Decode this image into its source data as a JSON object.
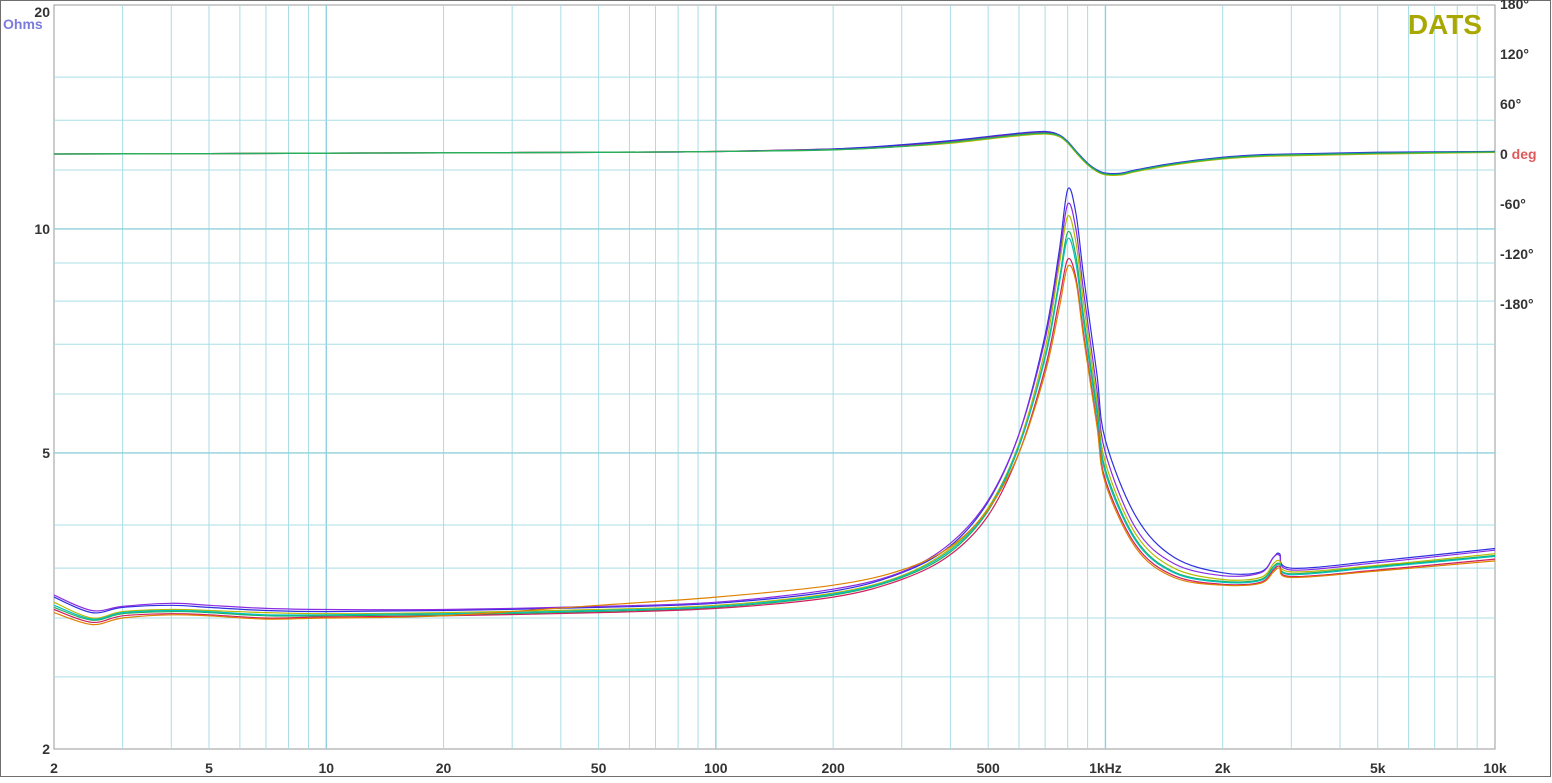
{
  "chart_data": {
    "type": "line",
    "logo": "DATS",
    "x_scale": "log",
    "xlim": [
      2,
      10000
    ],
    "x_ticks": [
      {
        "v": 2,
        "label": "2"
      },
      {
        "v": 5,
        "label": "5"
      },
      {
        "v": 10,
        "label": "10"
      },
      {
        "v": 20,
        "label": "20"
      },
      {
        "v": 50,
        "label": "50"
      },
      {
        "v": 100,
        "label": "100"
      },
      {
        "v": 200,
        "label": "200"
      },
      {
        "v": 500,
        "label": "500"
      },
      {
        "v": 1000,
        "label": "1kHz"
      },
      {
        "v": 2000,
        "label": "2k"
      },
      {
        "v": 5000,
        "label": "5k"
      },
      {
        "v": 10000,
        "label": "10k"
      }
    ],
    "y_left": {
      "unit_label": "Ohms",
      "scale": "log",
      "ylim": [
        2,
        20
      ],
      "ticks": [
        {
          "v": 20,
          "label": "20"
        },
        {
          "v": 10,
          "label": "10"
        },
        {
          "v": 5,
          "label": "5"
        },
        {
          "v": 2,
          "label": "2"
        }
      ]
    },
    "y_right": {
      "unit_label": "deg",
      "scale": "linear",
      "ylim": [
        -180,
        180
      ],
      "ticks": [
        {
          "v": 180,
          "label": "180°"
        },
        {
          "v": 120,
          "label": "120°"
        },
        {
          "v": 60,
          "label": "60°"
        },
        {
          "v": 0,
          "label": "0"
        },
        {
          "v": -60,
          "label": "-60°"
        },
        {
          "v": -120,
          "label": "-120°"
        },
        {
          "v": -180,
          "label": "-180°"
        }
      ]
    },
    "grid": true,
    "colors": {
      "grid": "#a8dde6",
      "grid_major": "#8fd0dc",
      "ohms_label": "#7b7bdc",
      "deg_label": "#e05a5a",
      "logo": "#a8a800"
    },
    "impedance_x": [
      2,
      2.5,
      3,
      4,
      5,
      7,
      10,
      20,
      50,
      100,
      200,
      300,
      400,
      500,
      600,
      700,
      760,
      800,
      840,
      880,
      950,
      1000,
      1200,
      1500,
      2000,
      2500,
      2700,
      2800,
      3000,
      5000,
      10000
    ],
    "phase_x": [
      2,
      5,
      10,
      20,
      50,
      100,
      200,
      300,
      400,
      500,
      600,
      700,
      760,
      800,
      850,
      900,
      950,
      1000,
      1100,
      1200,
      1500,
      2000,
      2500,
      3000,
      5000,
      10000
    ],
    "impedance_series": [
      {
        "color": "#3030e0",
        "values": [
          3.2,
          3.05,
          3.1,
          3.12,
          3.1,
          3.07,
          3.06,
          3.07,
          3.1,
          3.14,
          3.26,
          3.45,
          3.75,
          4.3,
          5.3,
          7.2,
          9.3,
          11.3,
          10.5,
          8.6,
          6.4,
          5.2,
          4.1,
          3.62,
          3.45,
          3.46,
          3.62,
          3.66,
          3.5,
          3.58,
          3.72
        ]
      },
      {
        "color": "#8a2be2",
        "values": [
          3.22,
          3.07,
          3.11,
          3.14,
          3.12,
          3.09,
          3.08,
          3.08,
          3.11,
          3.15,
          3.28,
          3.46,
          3.78,
          4.32,
          5.3,
          7.1,
          9.1,
          10.8,
          10.0,
          8.2,
          6.1,
          5.0,
          3.95,
          3.55,
          3.42,
          3.45,
          3.62,
          3.64,
          3.48,
          3.56,
          3.7
        ]
      },
      {
        "color": "#b8b800",
        "values": [
          3.15,
          3.0,
          3.06,
          3.08,
          3.07,
          3.05,
          3.04,
          3.05,
          3.08,
          3.12,
          3.24,
          3.42,
          3.72,
          4.22,
          5.15,
          6.9,
          8.9,
          10.4,
          9.6,
          7.9,
          5.9,
          4.85,
          3.88,
          3.5,
          3.38,
          3.4,
          3.55,
          3.58,
          3.46,
          3.53,
          3.66
        ]
      },
      {
        "color": "#20b060",
        "values": [
          3.1,
          2.98,
          3.04,
          3.06,
          3.05,
          3.02,
          3.02,
          3.03,
          3.06,
          3.1,
          3.22,
          3.4,
          3.68,
          4.18,
          5.1,
          6.75,
          8.5,
          9.9,
          9.2,
          7.6,
          5.75,
          4.75,
          3.82,
          3.46,
          3.36,
          3.38,
          3.52,
          3.55,
          3.44,
          3.52,
          3.64
        ]
      },
      {
        "color": "#00c0c0",
        "values": [
          3.12,
          2.99,
          3.05,
          3.07,
          3.06,
          3.03,
          3.03,
          3.04,
          3.07,
          3.11,
          3.23,
          3.41,
          3.7,
          4.2,
          5.12,
          6.7,
          8.4,
          9.7,
          9.0,
          7.45,
          5.65,
          4.7,
          3.8,
          3.45,
          3.35,
          3.37,
          3.5,
          3.54,
          3.43,
          3.51,
          3.63
        ]
      },
      {
        "color": "#d02060",
        "values": [
          3.08,
          2.96,
          3.02,
          3.04,
          3.03,
          3.0,
          3.01,
          3.02,
          3.05,
          3.09,
          3.2,
          3.38,
          3.65,
          4.12,
          5.0,
          6.5,
          8.0,
          9.1,
          8.6,
          7.2,
          5.5,
          4.6,
          3.75,
          3.42,
          3.33,
          3.35,
          3.48,
          3.52,
          3.41,
          3.48,
          3.6
        ]
      },
      {
        "color": "#e08000",
        "values": [
          3.05,
          2.94,
          3.0,
          3.03,
          3.02,
          2.99,
          3.0,
          3.02,
          3.12,
          3.2,
          3.32,
          3.48,
          3.74,
          4.2,
          5.0,
          6.4,
          7.8,
          8.9,
          8.5,
          7.1,
          5.45,
          4.55,
          3.72,
          3.4,
          3.32,
          3.34,
          3.46,
          3.5,
          3.4,
          3.47,
          3.58
        ]
      }
    ],
    "phase_series": [
      {
        "color": "#d02060",
        "values": [
          0,
          0.5,
          1,
          1.5,
          2,
          3,
          6,
          10,
          15,
          20,
          24,
          26,
          22,
          14,
          0,
          -12,
          -20,
          -24,
          -24,
          -20,
          -12,
          -5,
          -2,
          -1,
          1,
          3
        ]
      },
      {
        "color": "#3030e0",
        "values": [
          0,
          0.5,
          1,
          1.5,
          2,
          3,
          6,
          11,
          16,
          21,
          25,
          27,
          23,
          15,
          1,
          -11,
          -19,
          -23,
          -23,
          -19,
          -11,
          -4,
          -1,
          0,
          2,
          3
        ]
      },
      {
        "color": "#b8b800",
        "values": [
          0,
          0.5,
          1,
          1.5,
          2,
          3,
          5,
          9,
          13,
          18,
          22,
          24,
          21,
          13,
          -1,
          -13,
          -21,
          -25,
          -25,
          -21,
          -13,
          -6,
          -3,
          -2,
          0,
          2
        ]
      },
      {
        "color": "#20b060",
        "values": [
          0,
          0.5,
          1,
          1.5,
          2,
          3,
          5,
          9,
          14,
          19,
          23,
          25,
          22,
          14,
          0,
          -12,
          -20,
          -24,
          -24,
          -20,
          -12,
          -5,
          -2,
          -1,
          1,
          2.5
        ]
      }
    ]
  }
}
